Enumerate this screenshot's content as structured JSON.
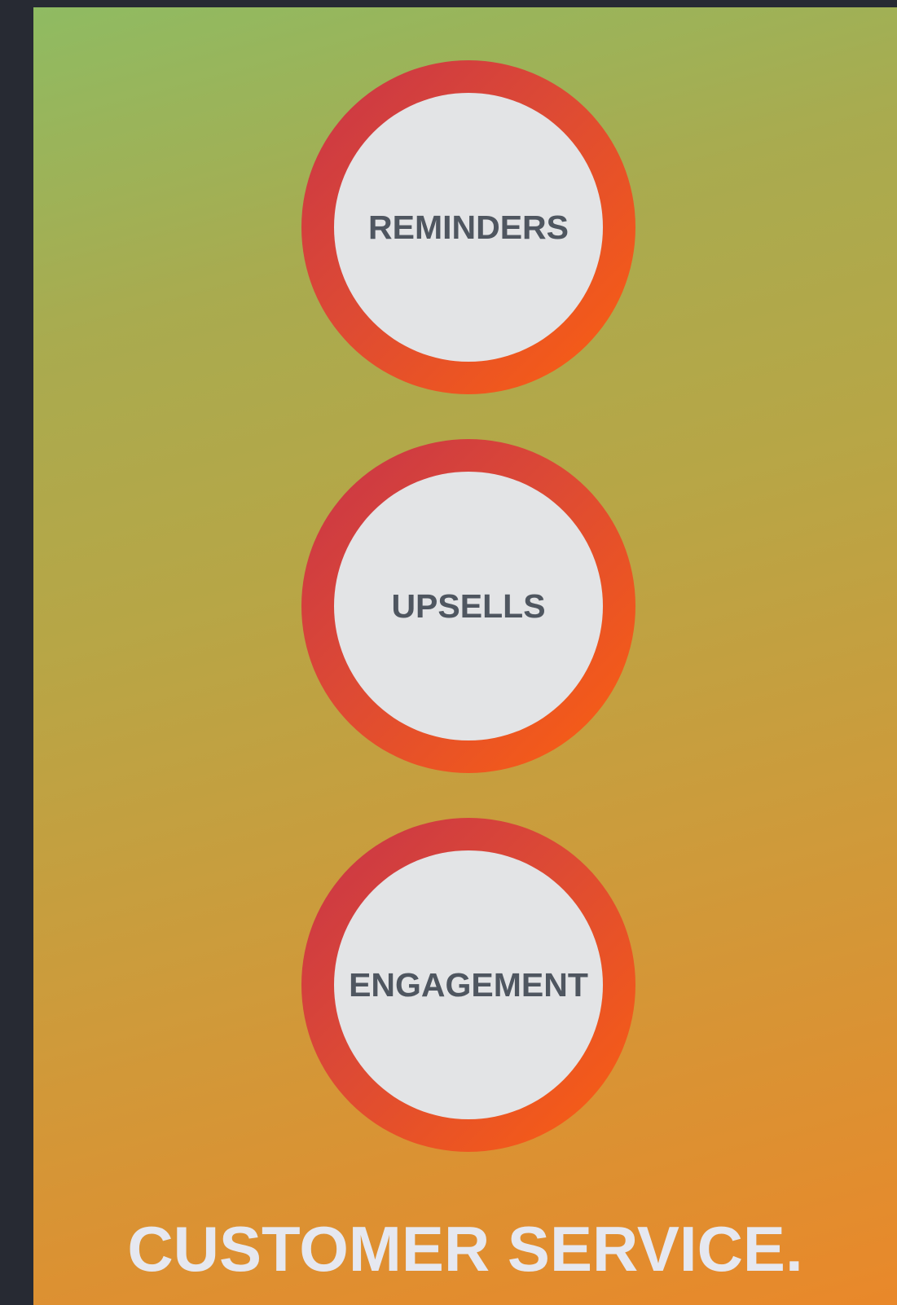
{
  "circles": [
    {
      "label": "REMINDERS"
    },
    {
      "label": "UPSELLS"
    },
    {
      "label": "ENGAGEMENT"
    }
  ],
  "footer": {
    "title": "CUSTOMER SERVICE."
  },
  "colors": {
    "background_outer": "#272a33",
    "gradient_top": "#8fbb62",
    "gradient_bottom": "#e9882a",
    "ring_start": "#c83448",
    "ring_end": "#fb6010",
    "circle_fill": "#e3e4e6",
    "label_text": "#4f5660",
    "title_text": "#e6e8f0"
  }
}
